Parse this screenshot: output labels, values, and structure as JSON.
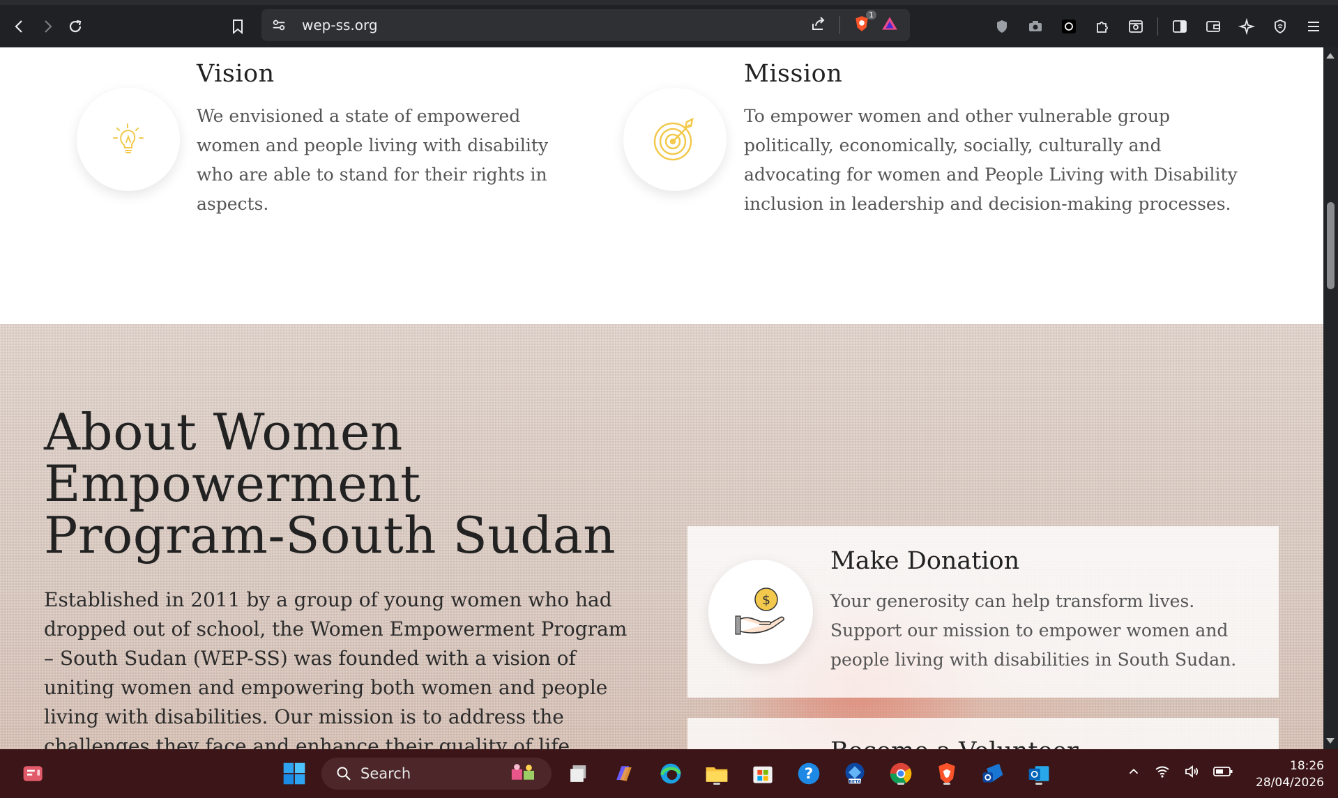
{
  "browser": {
    "url": "wep-ss.org",
    "shield_badge": "1"
  },
  "vision": {
    "title": "Vision",
    "text": "We envisioned a state of empowered women and people living with disability who are able to stand for their rights in aspects."
  },
  "mission": {
    "title": "Mission",
    "text": "To empower women and other vulnerable group politically, economically, socially, culturally and advocating for women and People Living with Disability inclusion in leadership and decision-making processes."
  },
  "about": {
    "title": "About Women Empowerment Program-South Sudan",
    "text": "Established in 2011 by a group of young women who had dropped out of school, the Women Empowerment Program – South Sudan (WEP-SS) was founded with a vision of uniting women and empowering both women and people living with disabilities. Our mission is to address the challenges they face and enhance their quality of life through several key"
  },
  "donation": {
    "title": "Make Donation",
    "text": "Your generosity can help transform lives. Support our mission to empower women and people living with disabilities in South Sudan.",
    "coin_symbol": "$"
  },
  "volunteer": {
    "title": "Become a Volunteer"
  },
  "taskbar": {
    "search_label": "Search",
    "time": "18:26",
    "date": "28/04/2026"
  },
  "colors": {
    "icon_yellow": "#f2c94c",
    "chrome_bg": "#202124",
    "taskbar_bg": "#3b1517"
  }
}
